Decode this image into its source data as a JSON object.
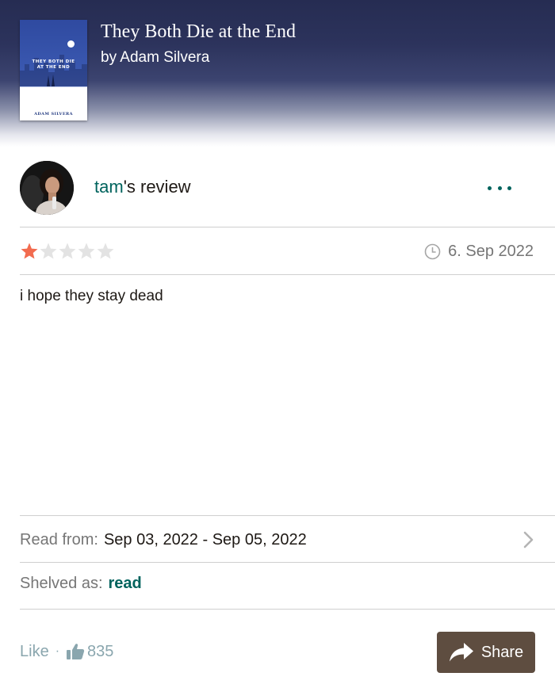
{
  "book": {
    "title": "They Both Die at the End",
    "author": "by Adam Silvera",
    "cover_title": "THEY BOTH DIE\nAT THE END",
    "cover_author": "ADAM SILVERA"
  },
  "review": {
    "reviewer_name": "tam",
    "heading_suffix": "'s review",
    "rating": 1,
    "max_rating": 5,
    "date": "6. Sep 2022",
    "text": "i hope they stay dead"
  },
  "read": {
    "label": "Read from:",
    "dates": "Sep 03, 2022 - Sep 05, 2022"
  },
  "shelf": {
    "label": "Shelved as:",
    "name": "read"
  },
  "actions": {
    "like_label": "Like",
    "separator": "·",
    "like_count": "835",
    "share_label": "Share"
  },
  "icons": {
    "more": "more-dots-icon",
    "clock": "clock-icon",
    "chevron": "chevron-right-icon",
    "thumb": "thumbs-up-icon",
    "share": "share-arrow-icon",
    "star": "star-icon"
  },
  "colors": {
    "brand_green": "#00635d",
    "star_filled": "#f26b4f",
    "star_empty": "#e3e3e3",
    "share_bg": "#5e4d40",
    "muted_text": "#767676",
    "like_text": "#8aa6ae",
    "header_navy": "#262c52"
  }
}
